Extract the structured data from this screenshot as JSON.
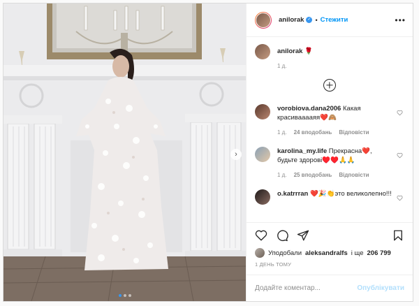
{
  "post": {
    "username": "anilorak",
    "follow_label": "Стежити",
    "separator": "•",
    "caption_emoji": "🌹",
    "caption_time": "1 д."
  },
  "comments": [
    {
      "username": "vorobiova.dana2006",
      "text": "Какая красивааааяя❤️🙈",
      "time": "1 д.",
      "likes": "24 вподобань",
      "reply": "Відповісти"
    },
    {
      "username": "karolina_my.life",
      "text": "Прекрасна❤️, будьте здорові♥️♥️🙏🙏",
      "time": "1 д.",
      "likes": "25 вподобань",
      "reply": "Відповісти"
    },
    {
      "username": "o.katrrran",
      "text": "❤️🎉👏это великолепно!!!",
      "time": "",
      "likes": "",
      "reply": ""
    }
  ],
  "likes": {
    "prefix": "Уподобали",
    "user": "aleksandralfs",
    "middle": "і ще",
    "count": "206 799"
  },
  "timestamp": "1 ДЕНЬ ТОМУ",
  "comment_box": {
    "placeholder": "Додайте коментар...",
    "publish_label": "Опублікувати"
  },
  "colors": {
    "accent": "#0095f6",
    "verified": "#3897f0"
  }
}
